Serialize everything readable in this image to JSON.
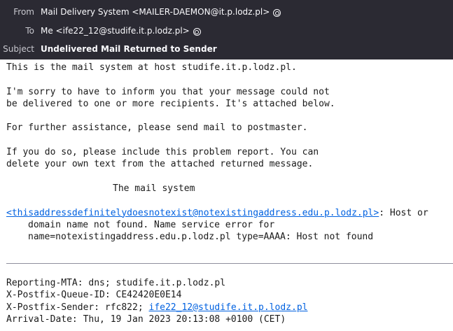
{
  "headers": {
    "from_label": "From",
    "from_value": "Mail Delivery System <MAILER-DAEMON@it.p.lodz.pl>",
    "to_label": "To",
    "to_value": "Me <ife22_12@studife.it.p.lodz.pl>",
    "subject_label": "Subject",
    "subject_value": "Undelivered Mail Returned to Sender"
  },
  "message": {
    "l1": "This is the mail system at host studife.it.p.lodz.pl.",
    "l2": "I'm sorry to have to inform you that your message could not",
    "l3": "be delivered to one or more recipients. It's attached below.",
    "l4": "For further assistance, please send mail to postmaster.",
    "l5": "If you do so, please include this problem report. You can",
    "l6": "delete your own text from the attached returned message.",
    "l7": "The mail system",
    "recipient_link": "<thisaddressdefinitelydoesnotexist@notexistingaddress.edu.p.lodz.pl>",
    "error_tail": ": Host or",
    "error_l2": "domain name not found. Name service error for",
    "error_l3": "name=notexistingaddress.edu.p.lodz.pl type=AAAA: Host not found"
  },
  "report": {
    "reporting_mta": "Reporting-MTA: dns; studife.it.p.lodz.pl",
    "queue_id": "X-Postfix-Queue-ID: CE42420E0E14",
    "sender_prefix": "X-Postfix-Sender: rfc822; ",
    "sender_link": "ife22_12@studife.it.p.lodz.pl",
    "arrival_date": "Arrival-Date: Thu, 19 Jan 2023 20:13:08 +0100 (CET)"
  },
  "icons": {
    "from_contact": "contact-icon",
    "to_contact": "contact-icon"
  },
  "colors": {
    "header_bg": "#2b2a33",
    "link": "#0061e0"
  }
}
